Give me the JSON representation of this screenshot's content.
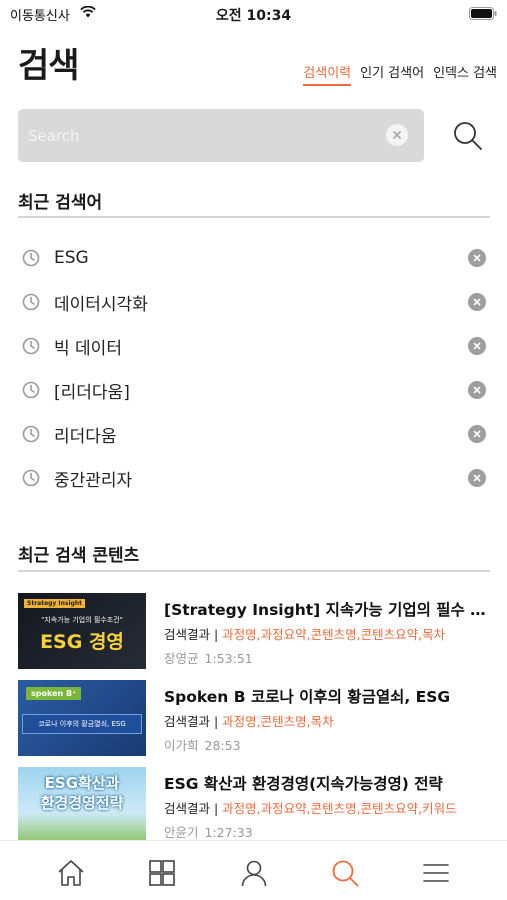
{
  "status_bar": {
    "carrier": "이동통신사",
    "time": "오전 10:34"
  },
  "header": {
    "title": "검색",
    "tabs": [
      {
        "label": "검색이력",
        "active": true
      },
      {
        "label": "인기 검색어",
        "active": false
      },
      {
        "label": "인덱스 검색",
        "active": false
      }
    ]
  },
  "search": {
    "placeholder": "Search",
    "value": ""
  },
  "recent_searches": {
    "title": "최근 검색어",
    "items": [
      {
        "label": "ESG"
      },
      {
        "label": "데이터시각화"
      },
      {
        "label": "빅 데이터"
      },
      {
        "label": "[리더다움]"
      },
      {
        "label": "리더다움"
      },
      {
        "label": "중간관리자"
      }
    ]
  },
  "recent_contents": {
    "title": "최근 검색 콘텐츠",
    "items": [
      {
        "title": "[Strategy Insight] 지속가능 기업의 필수 조건 ESG 경영",
        "meta_label": "검색결과 | ",
        "meta_fields": "과정명,과정요약,콘텐츠명,콘텐츠요약,목차",
        "author": "장영균",
        "duration": "1:53:51",
        "thumb": {
          "tag": "Strategy Insight",
          "line1": "\"지속가능 기업의 필수조건\"",
          "line2": "ESG 경영"
        }
      },
      {
        "title": "Spoken B 코로나 이후의 황금열쇠, ESG",
        "meta_label": "검색결과 | ",
        "meta_fields": "과정명,콘텐츠명,목차",
        "author": "이가희",
        "duration": "28:53",
        "thumb": {
          "tag": "spoken B⁺",
          "line1": "코로나 이후의 황금열쇠, ESG"
        }
      },
      {
        "title": "ESG 확산과 환경경영(지속가능경영) 전략",
        "meta_label": "검색결과 | ",
        "meta_fields": "과정명,과정요약,콘텐츠명,콘텐츠요약,키워드",
        "author": "안윤기",
        "duration": "1:27:33",
        "thumb": {
          "line1": "ESG확산과",
          "line2": "환경경영전략"
        }
      }
    ]
  },
  "colors": {
    "accent": "#ef6b3b",
    "search_bg": "#d9d9d9",
    "divider": "#d5d5d5",
    "muted": "#9a9a9a"
  },
  "tab_bar": [
    "home-icon",
    "category-icon",
    "user-icon",
    "search-icon",
    "menu-icon"
  ]
}
